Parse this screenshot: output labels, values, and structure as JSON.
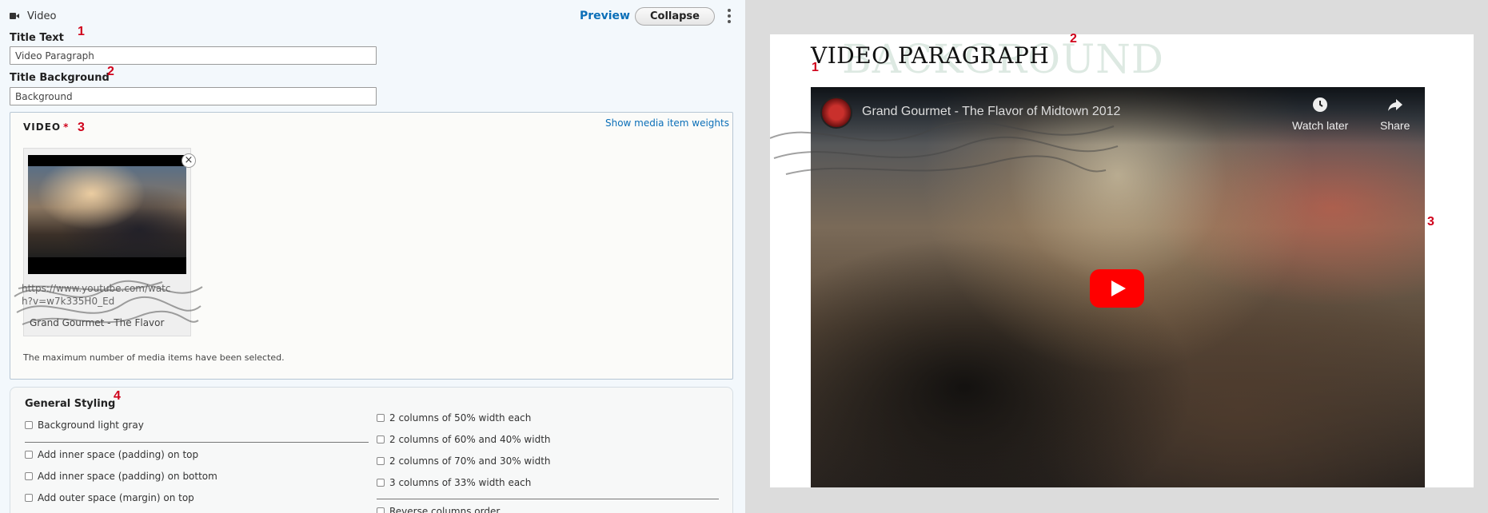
{
  "editor": {
    "paragraph_type": "Video",
    "preview_label": "Preview",
    "collapse_label": "Collapse",
    "title_text": {
      "label": "Title Text",
      "value": "Video Paragraph",
      "marker": "1"
    },
    "title_background": {
      "label": "Title Background",
      "value": "Background",
      "marker": "2"
    },
    "video": {
      "legend": "VIDEO",
      "required_mark": "*",
      "marker": "3",
      "weights_link": "Show media item weights",
      "media_item": {
        "url": "https://www.youtube.com/watch?v=w7k335H0_Ed",
        "caption": "Grand Gourmet - The Flavor",
        "remove_symbol": "×"
      },
      "max_note": "The maximum number of media items have been selected."
    },
    "general_styling": {
      "title": "General Styling",
      "marker": "4",
      "left_options": [
        "Background light gray",
        "Add inner space (padding) on top",
        "Add inner space (padding) on bottom",
        "Add outer space (margin) on top"
      ],
      "right_options": [
        "2 columns of 50% width each",
        "2 columns of 60% and 40% width",
        "2 columns of 70% and 30% width",
        "3 columns of 33% width each",
        "Reverse columns order"
      ]
    }
  },
  "preview": {
    "title": "VIDEO PARAGRAPH",
    "background_title": "BACKGROUND",
    "markers": {
      "title": "1",
      "background": "2",
      "video": "3"
    },
    "youtube": {
      "video_title": "Grand Gourmet - The Flavor of Midtown 2012",
      "watch_later": "Watch later",
      "share": "Share"
    }
  },
  "colors": {
    "link_blue": "#0b6fb8",
    "marker_red": "#d0021b",
    "youtube_red": "#ff0000"
  }
}
